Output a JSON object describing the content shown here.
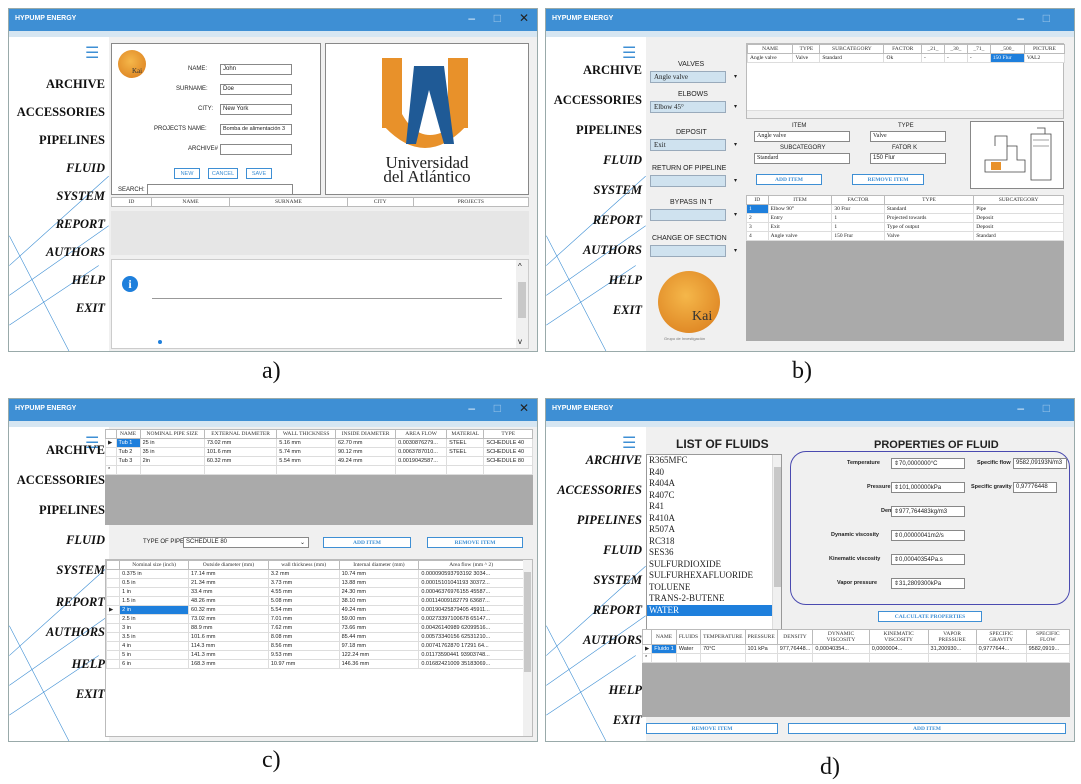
{
  "app_title": "HYPUMP ENERGY",
  "window_buttons": {
    "min": "–",
    "max": "□",
    "close": "✕"
  },
  "menu": {
    "archive": "ARCHIVE",
    "accessories": "ACCESSORIES",
    "pipelines": "PIPELINES",
    "fluid": "FLUID",
    "system": "SYSTEM",
    "report": "REPORT",
    "authors": "AUTHORS",
    "help": "HELP",
    "exit": "EXIT"
  },
  "captions": {
    "a": "a)",
    "b": "b)",
    "c": "c)",
    "d": "d)"
  },
  "logo": {
    "name": "Kai",
    "subtitle": "Grupo de Investigación"
  },
  "panel_a": {
    "name_label": "NAME:",
    "name_value": "John",
    "surname_label": "SURNAME:",
    "surname_value": "Doe",
    "city_label": "CITY:",
    "city_value": "New York",
    "projects_label": "PROJECTS NAME:",
    "projects_value": "Bomba de alimentación 3",
    "archive_label": "ARCHIVE#",
    "new": "NEW",
    "cancel": "CANCEL",
    "save": "SAVE",
    "search_label": "SEARCH:",
    "university_line1": "Universidad",
    "university_line2": "del Atlántico",
    "columns": [
      "ID",
      "NAME",
      "SURNAME",
      "CITY",
      "PROJECTS"
    ],
    "info_icon": "info-icon"
  },
  "panel_b": {
    "valves_label": "VALVES",
    "valves_value": "Angle valve",
    "elbows_label": "ELBOWS",
    "elbows_value": "Elbow 45°",
    "deposit_label": "DEPOSIT",
    "deposit_value": "Exit",
    "return_label": "RETURN OF PIPELINE",
    "bypass_label": "BYPASS IN T",
    "change_label": "CHANGE OF SECTION",
    "top_columns": [
      "NAME",
      "TYPE",
      "SUBCATEGORY",
      "FACTOR",
      "_21_",
      "_30_",
      "_71_",
      "_500_",
      "PICTURE"
    ],
    "top_row": [
      "Angle valve",
      "Valve",
      "Standard",
      "Ok",
      "-",
      "-",
      "-",
      "150 Flur",
      "VAL2"
    ],
    "item_label": "ITEM",
    "item_value": "Angle valve",
    "type_label": "TYPE",
    "type_value": "Valve",
    "subcat_label": "SUBCATEGORY",
    "subcat_value": "Standard",
    "factor_label": "FATOR K",
    "factor_value": "150 Flur",
    "add_item": "ADD ITEM",
    "remove_item": "REMOVE ITEM",
    "bottom_columns": [
      "ID",
      "ITEM",
      "FACTOR",
      "TYPE",
      "SUBCATEGORY"
    ],
    "bottom_rows": [
      [
        "1",
        "Elbow 90°",
        "30 Ftur",
        "Standard",
        "Pipe"
      ],
      [
        "2",
        "Entry",
        "1",
        "Projected towards",
        "Deposit"
      ],
      [
        "3",
        "Exit",
        "1",
        "Type of output",
        "Deposit"
      ],
      [
        "4",
        "Angle valve",
        "150 Ftur",
        "Valve",
        "Standard"
      ]
    ]
  },
  "panel_c": {
    "columns": [
      "NAME",
      "NOMINAL PIPE SIZE",
      "EXTERNAL DIAMETER",
      "WALL THICKNESS",
      "INSIDE DIAMETER",
      "AREA FLOW",
      "MATERIAL",
      "TYPE"
    ],
    "rows": [
      [
        "Tub 1",
        "25 in",
        "73.02 mm",
        "5.16 mm",
        "62.70 mm",
        "0.0030876279...",
        "STEEL",
        "SCHEDULE 40"
      ],
      [
        "Tub 2",
        "35 in",
        "101.6 mm",
        "5.74 mm",
        "90.12 mm",
        "0.0063787010...",
        "STEEL",
        "SCHEDULE 40"
      ],
      [
        "Tub 3",
        "2in",
        "60.32 mm",
        "5.54 mm",
        "49.24 mm",
        "0.0019042587...",
        "",
        "SCHEDULE 80"
      ]
    ],
    "type_of_pipe_label": "TYPE OF PIPE:",
    "type_of_pipe_value": "SCHEDULE 80",
    "add_item": "ADD ITEM",
    "remove_item": "REMOVE ITEM",
    "spec_columns": [
      "Nominal size (inch)",
      "Outside diameter (mm)",
      "wall thickness (mm)",
      "Internal diameter (mm)",
      "Area flow (mm ^ 2)"
    ],
    "spec_rows": [
      [
        "0.375 in",
        "17.14 mm",
        "3.2 mm",
        "10.74 mm",
        "0.000090593793192 3034..."
      ],
      [
        "0.5 in",
        "21.34 mm",
        "3.73 mm",
        "13.88 mm",
        "0.00015101041193 30372..."
      ],
      [
        "1 in",
        "33.4 mm",
        "4.55 mm",
        "24.30 mm",
        "0.00046376976155 45587..."
      ],
      [
        "1.5 in",
        "48.26 mm",
        "5.08 mm",
        "38.10 mm",
        "0.00114009182779 63687..."
      ],
      [
        "2 in",
        "60.32 mm",
        "5.54 mm",
        "49.24 mm",
        "0.00190425879405 45911..."
      ],
      [
        "2.5 in",
        "73.02 mm",
        "7.01 mm",
        "59.00 mm",
        "0.00273397100678 65147..."
      ],
      [
        "3 in",
        "88.9 mm",
        "7.62 mm",
        "73.66 mm",
        "0.00426140989 62099516..."
      ],
      [
        "3.5 in",
        "101.6 mm",
        "8.08 mm",
        "85.44 mm",
        "0.00573340156 62531210..."
      ],
      [
        "4 in",
        "114.3 mm",
        "8.56 mm",
        "97.18 mm",
        "0.00741762870 17291 64..."
      ],
      [
        "5 in",
        "141.3 mm",
        "9.53 mm",
        "122.24 mm",
        "0.01173590441 93903748..."
      ],
      [
        "6 in",
        "168.3 mm",
        "10.97 mm",
        "146.36 mm",
        "0.01682421009 35183069..."
      ]
    ]
  },
  "panel_d": {
    "list_title": "LIST OF FLUIDS",
    "fluids": [
      "R365MFC",
      "R40",
      "R404A",
      "R407C",
      "R41",
      "R410A",
      "R507A",
      "RC318",
      "SES36",
      "SULFURDIOXIDE",
      "SULFURHEXAFLUORIDE",
      "TOLUENE",
      "TRANS-2-BUTENE",
      "WATER"
    ],
    "props_title": "PROPERTIES OF FLUID",
    "temperature_label": "Temperature",
    "temperature_value": "70,0000000",
    "temperature_unit": "°C",
    "pressure_label": "Pressure",
    "pressure_value": "101,000000",
    "pressure_unit": "kPa",
    "density_label": "Density",
    "density_value": "977,764483",
    "density_unit": "kg/m3",
    "dynvisc_label": "Dynamic viscosity",
    "dynvisc_value": "0,00000041",
    "dynvisc_unit": "m2/s",
    "kinvisc_label": "Kinematic viscosity",
    "kinvisc_value": "0,00040354",
    "kinvisc_unit": "Pa.s",
    "vapor_label": "Vapor pressure",
    "vapor_value": "31,2809300",
    "vapor_unit": "kPa",
    "specflow_label": "Specific flow",
    "specflow_value": "9582,09193",
    "specflow_unit": "N/m3",
    "specgrav_label": "Specific gravity",
    "specgrav_value": "0,97776448",
    "calculate": "CALCULATE PROPERTIES",
    "columns": [
      "NAME",
      "FLUIDS",
      "TEMPERATURE",
      "PRESSURE",
      "DENSITY",
      "DYNAMIC VISCOSITY",
      "KINEMATIC VISCOSITY",
      "VAPOR PRESSURE",
      "SPECIFIC GRAVITY",
      "SPECIFIC FLOW"
    ],
    "row": [
      "Fluido 1",
      "Water",
      "70°C",
      "101 kPa",
      "977,76448...",
      "0,00040354...",
      "0,0000004...",
      "31,200930...",
      "0,9777644...",
      "9582,0919..."
    ],
    "remove_item": "REMOVE ITEM",
    "add_item": "ADD ITEM"
  },
  "colors": {
    "accent": "#3e8fd4",
    "selection": "#1e7fdc",
    "gray": "#aaaaaa",
    "logo_orange": "#e8912a"
  }
}
